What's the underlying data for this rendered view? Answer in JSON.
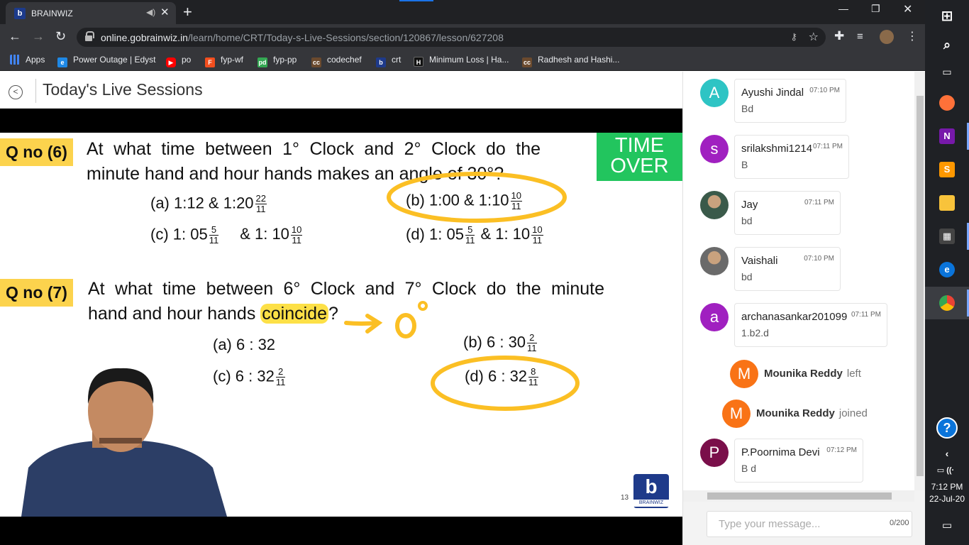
{
  "browser": {
    "tab_title": "BRAINWIZ",
    "new_tab_label": "+",
    "url_host": "online.gobrainwiz.in",
    "url_path": "/learn/home/CRT/Today-s-Live-Sessions/section/120867/lesson/627208",
    "bookmarks": [
      {
        "label": "Apps"
      },
      {
        "label": "Power Outage | Edyst"
      },
      {
        "label": "po"
      },
      {
        "label": "fyp-wf"
      },
      {
        "label": "fyp-pp"
      },
      {
        "label": "codechef"
      },
      {
        "label": "crt"
      },
      {
        "label": "Minimum Loss | Ha..."
      },
      {
        "label": "Radhesh and Hashi..."
      }
    ]
  },
  "page": {
    "title": "Today's Live Sessions"
  },
  "slide": {
    "q6": {
      "label": "Q no (6)",
      "line1": "At what time between 1° Clock and 2° Clock do the",
      "line2": "minute hand and hour hands makes an angle of 30°?",
      "a": {
        "prefix": "(a) 1:12  &  1:20",
        "num": "22",
        "den": "11"
      },
      "b": {
        "prefix": "(b) 1:00 & 1:10",
        "num": "10",
        "den": "11"
      },
      "c": {
        "prefix": "(c) 1: 05",
        "num": "5",
        "den": "11",
        "mid": "&  1: 10",
        "num2": "10",
        "den2": "11"
      },
      "d": {
        "prefix": "(d) 1: 05",
        "num": "5",
        "den": "11",
        "mid": "& 1: 10",
        "num2": "10",
        "den2": "11"
      }
    },
    "time_over_line1": "TIME",
    "time_over_line2": "OVER",
    "q7": {
      "label": "Q no (7)",
      "line1": "At what time between 6° Clock and 7° Clock do the minute",
      "line2_pre": "hand and hour hands ",
      "line2_hl": "coincide",
      "line2_post": "?",
      "a": "(a)  6 : 32",
      "b": {
        "prefix": "(b)  6 : 30",
        "num": "2",
        "den": "11"
      },
      "c": {
        "prefix": "(c)  6 : 32",
        "num": "2",
        "den": "11"
      },
      "d": {
        "prefix": "(d)  6 : 32",
        "num": "8",
        "den": "11"
      }
    },
    "annotation": "0°",
    "slide_number": "13",
    "brand_letter": "b",
    "brand_name": "BRAINWIZ"
  },
  "chat": {
    "messages": [
      {
        "initial": "A",
        "name": "Ayushi Jindal",
        "time": "07:10 PM",
        "text": "Bd",
        "avatar_color": "#2ec4c4"
      },
      {
        "initial": "s",
        "name": "srilakshmi1214",
        "time": "07:11 PM",
        "text": "B",
        "avatar_color": "#a020c0"
      },
      {
        "initial": "",
        "name": "Jay",
        "time": "07:11 PM",
        "text": "bd",
        "avatar_color": "#3a5a4a"
      },
      {
        "initial": "",
        "name": "Vaishali",
        "time": "07:10 PM",
        "text": "bd",
        "avatar_color": "#6a6a6a"
      },
      {
        "initial": "a",
        "name": "archanasankar201099",
        "time": "07:11 PM",
        "text": "1.b2.d",
        "avatar_color": "#a020c0"
      },
      {
        "initial": "P",
        "name": "P.Poornima Devi",
        "time": "07:12 PM",
        "text": "B d",
        "avatar_color": "#7a0f4a"
      }
    ],
    "events": [
      {
        "initial": "M",
        "name": "Mounika Reddy",
        "event": "left"
      },
      {
        "initial": "M",
        "name": "Mounika Reddy",
        "event": "joined"
      }
    ],
    "input_placeholder": "Type your message...",
    "char_counter": "0/200"
  },
  "taskbar": {
    "time": "7:12 PM",
    "date": "22-Jul-20"
  }
}
